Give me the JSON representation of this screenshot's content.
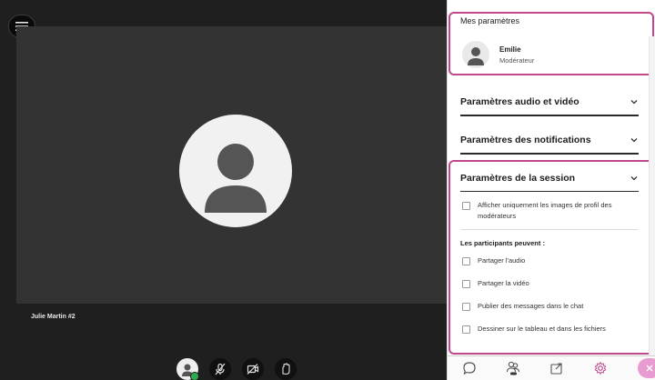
{
  "stage": {
    "participant_name": "Julie Martin #2"
  },
  "panel": {
    "title": "Mes paramètres",
    "user": {
      "name": "Emilie",
      "role": "Modérateur"
    },
    "sections": [
      {
        "label": "Paramètres audio et vidéo"
      },
      {
        "label": "Paramètres des notifications"
      },
      {
        "label": "Paramètres de la session"
      }
    ],
    "session": {
      "option_moderator_images": "Afficher uniquement les images de profil des modérateurs",
      "participants_heading": "Les participants peuvent :",
      "options": [
        "Partager l'audio",
        "Partager la vidéo",
        "Publier des messages dans le chat",
        "Dessiner sur le tableau et dans les fichiers"
      ]
    }
  },
  "icons": {
    "menu": "menu-icon",
    "mic": "mic-off-icon",
    "camera": "camera-off-icon",
    "hand": "raise-hand-icon",
    "chat": "chat-icon",
    "participants": "participants-icon",
    "share": "share-icon",
    "settings": "settings-icon",
    "close": "close-icon"
  },
  "colors": {
    "highlight": "#c2468b",
    "active_tab": "#c2468b",
    "status_online": "#2eab4f",
    "close_button": "#e89bd0"
  }
}
